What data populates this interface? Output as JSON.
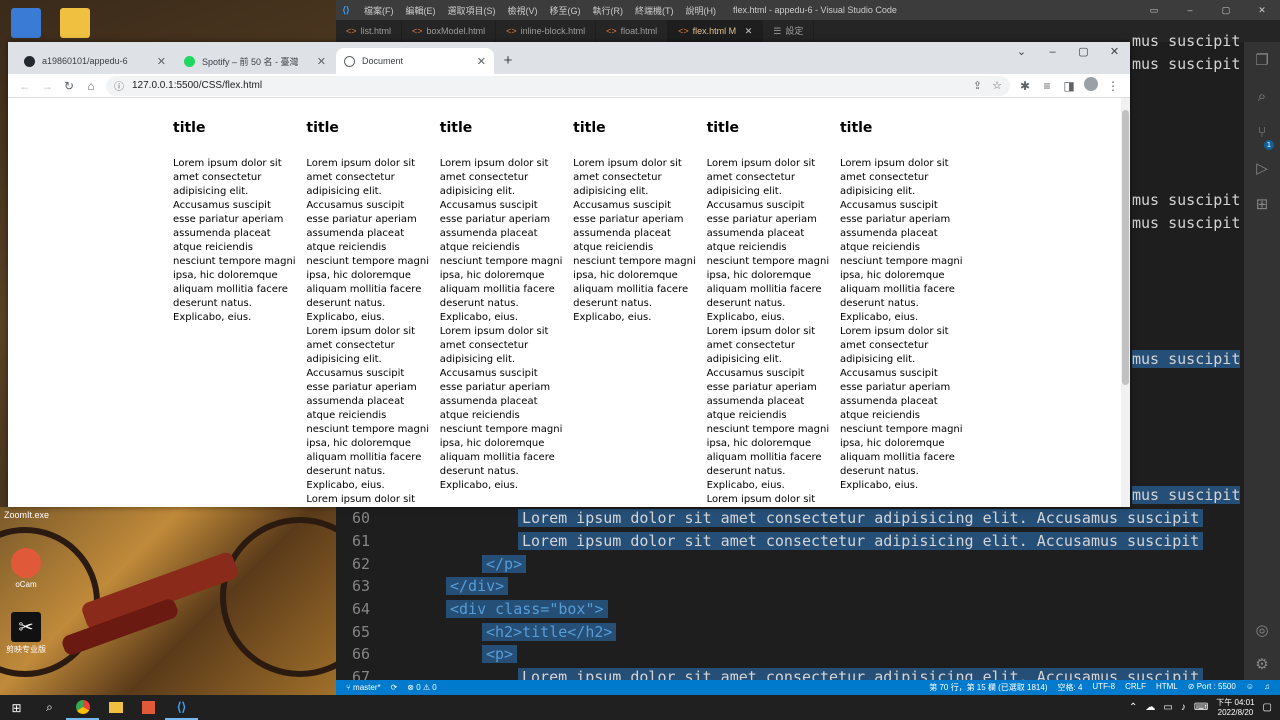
{
  "desktop": {
    "icons": [
      {
        "label": "",
        "color": "#3a7bd5"
      },
      {
        "label": "",
        "color": "#f0c040"
      }
    ],
    "zoomit_label": "ZoomIt.exe",
    "bottom_icons": [
      {
        "label": "oCam",
        "color": "#e05a3a"
      },
      {
        "label": "剪映专业版",
        "color": "#111111"
      }
    ]
  },
  "vscode": {
    "menu": [
      "檔案(F)",
      "編輯(E)",
      "選取項目(S)",
      "檢視(V)",
      "移至(G)",
      "執行(R)",
      "終端機(T)",
      "說明(H)"
    ],
    "title": "flex.html - appedu-6 - Visual Studio Code",
    "tabs": [
      "list.html",
      "boxModel.html",
      "inline-block.html",
      "float.html",
      "flex.html M",
      "設定"
    ],
    "active_tab_index": 4,
    "peek_text": "mus suscipit",
    "code_lines": [
      {
        "num": "60",
        "text": "Lorem ipsum dolor sit amet consectetur adipisicing elit. Accusamus suscipit"
      },
      {
        "num": "61",
        "text": "Lorem ipsum dolor sit amet consectetur adipisicing elit. Accusamus suscipit"
      },
      {
        "num": "62",
        "text": "</p>"
      },
      {
        "num": "63",
        "text": "</div>"
      },
      {
        "num": "64",
        "text": "<div class=\"box\">"
      },
      {
        "num": "65",
        "text": "<h2>title</h2>"
      },
      {
        "num": "66",
        "text": "<p>"
      },
      {
        "num": "67",
        "text": "Lorem ipsum dolor sit amet consectetur adipisicing elit. Accusamus suscipit"
      }
    ],
    "status": {
      "branch": "master*",
      "problems": "⊗ 0 ⚠ 0",
      "position": "第 70 行，第 15 欄 (已選取 1814)",
      "spaces": "空格: 4",
      "encoding": "UTF-8",
      "eol": "CRLF",
      "language": "HTML",
      "port": "Port : 5500"
    }
  },
  "chrome": {
    "tabs": [
      {
        "label": "a19860101/appedu-6",
        "icon_color": "#24292f"
      },
      {
        "label": "Spotify – 前 50 名 - 臺灣",
        "icon_color": "#1ed760"
      },
      {
        "label": "Document",
        "icon_color": "#5f6368"
      }
    ],
    "active_tab_index": 2,
    "url": "127.0.0.1:5500/CSS/flex.html"
  },
  "page": {
    "boxes": [
      {
        "title": "title",
        "paragraphs": 1
      },
      {
        "title": "title",
        "paragraphs": 3
      },
      {
        "title": "title",
        "paragraphs": 2
      },
      {
        "title": "title",
        "paragraphs": 1
      },
      {
        "title": "title",
        "paragraphs": 3
      },
      {
        "title": "title",
        "paragraphs": 2
      }
    ],
    "lorem": "Lorem ipsum dolor sit amet consectetur adipisicing elit. Accusamus suscipit esse pariatur aperiam assumenda placeat atque reiciendis nesciunt tempore magni ipsa, hic doloremque aliquam mollitia facere deserunt natus. Explicabo, eius."
  },
  "taskbar": {
    "time": "下午 04:01",
    "date": "2022/8/20"
  }
}
